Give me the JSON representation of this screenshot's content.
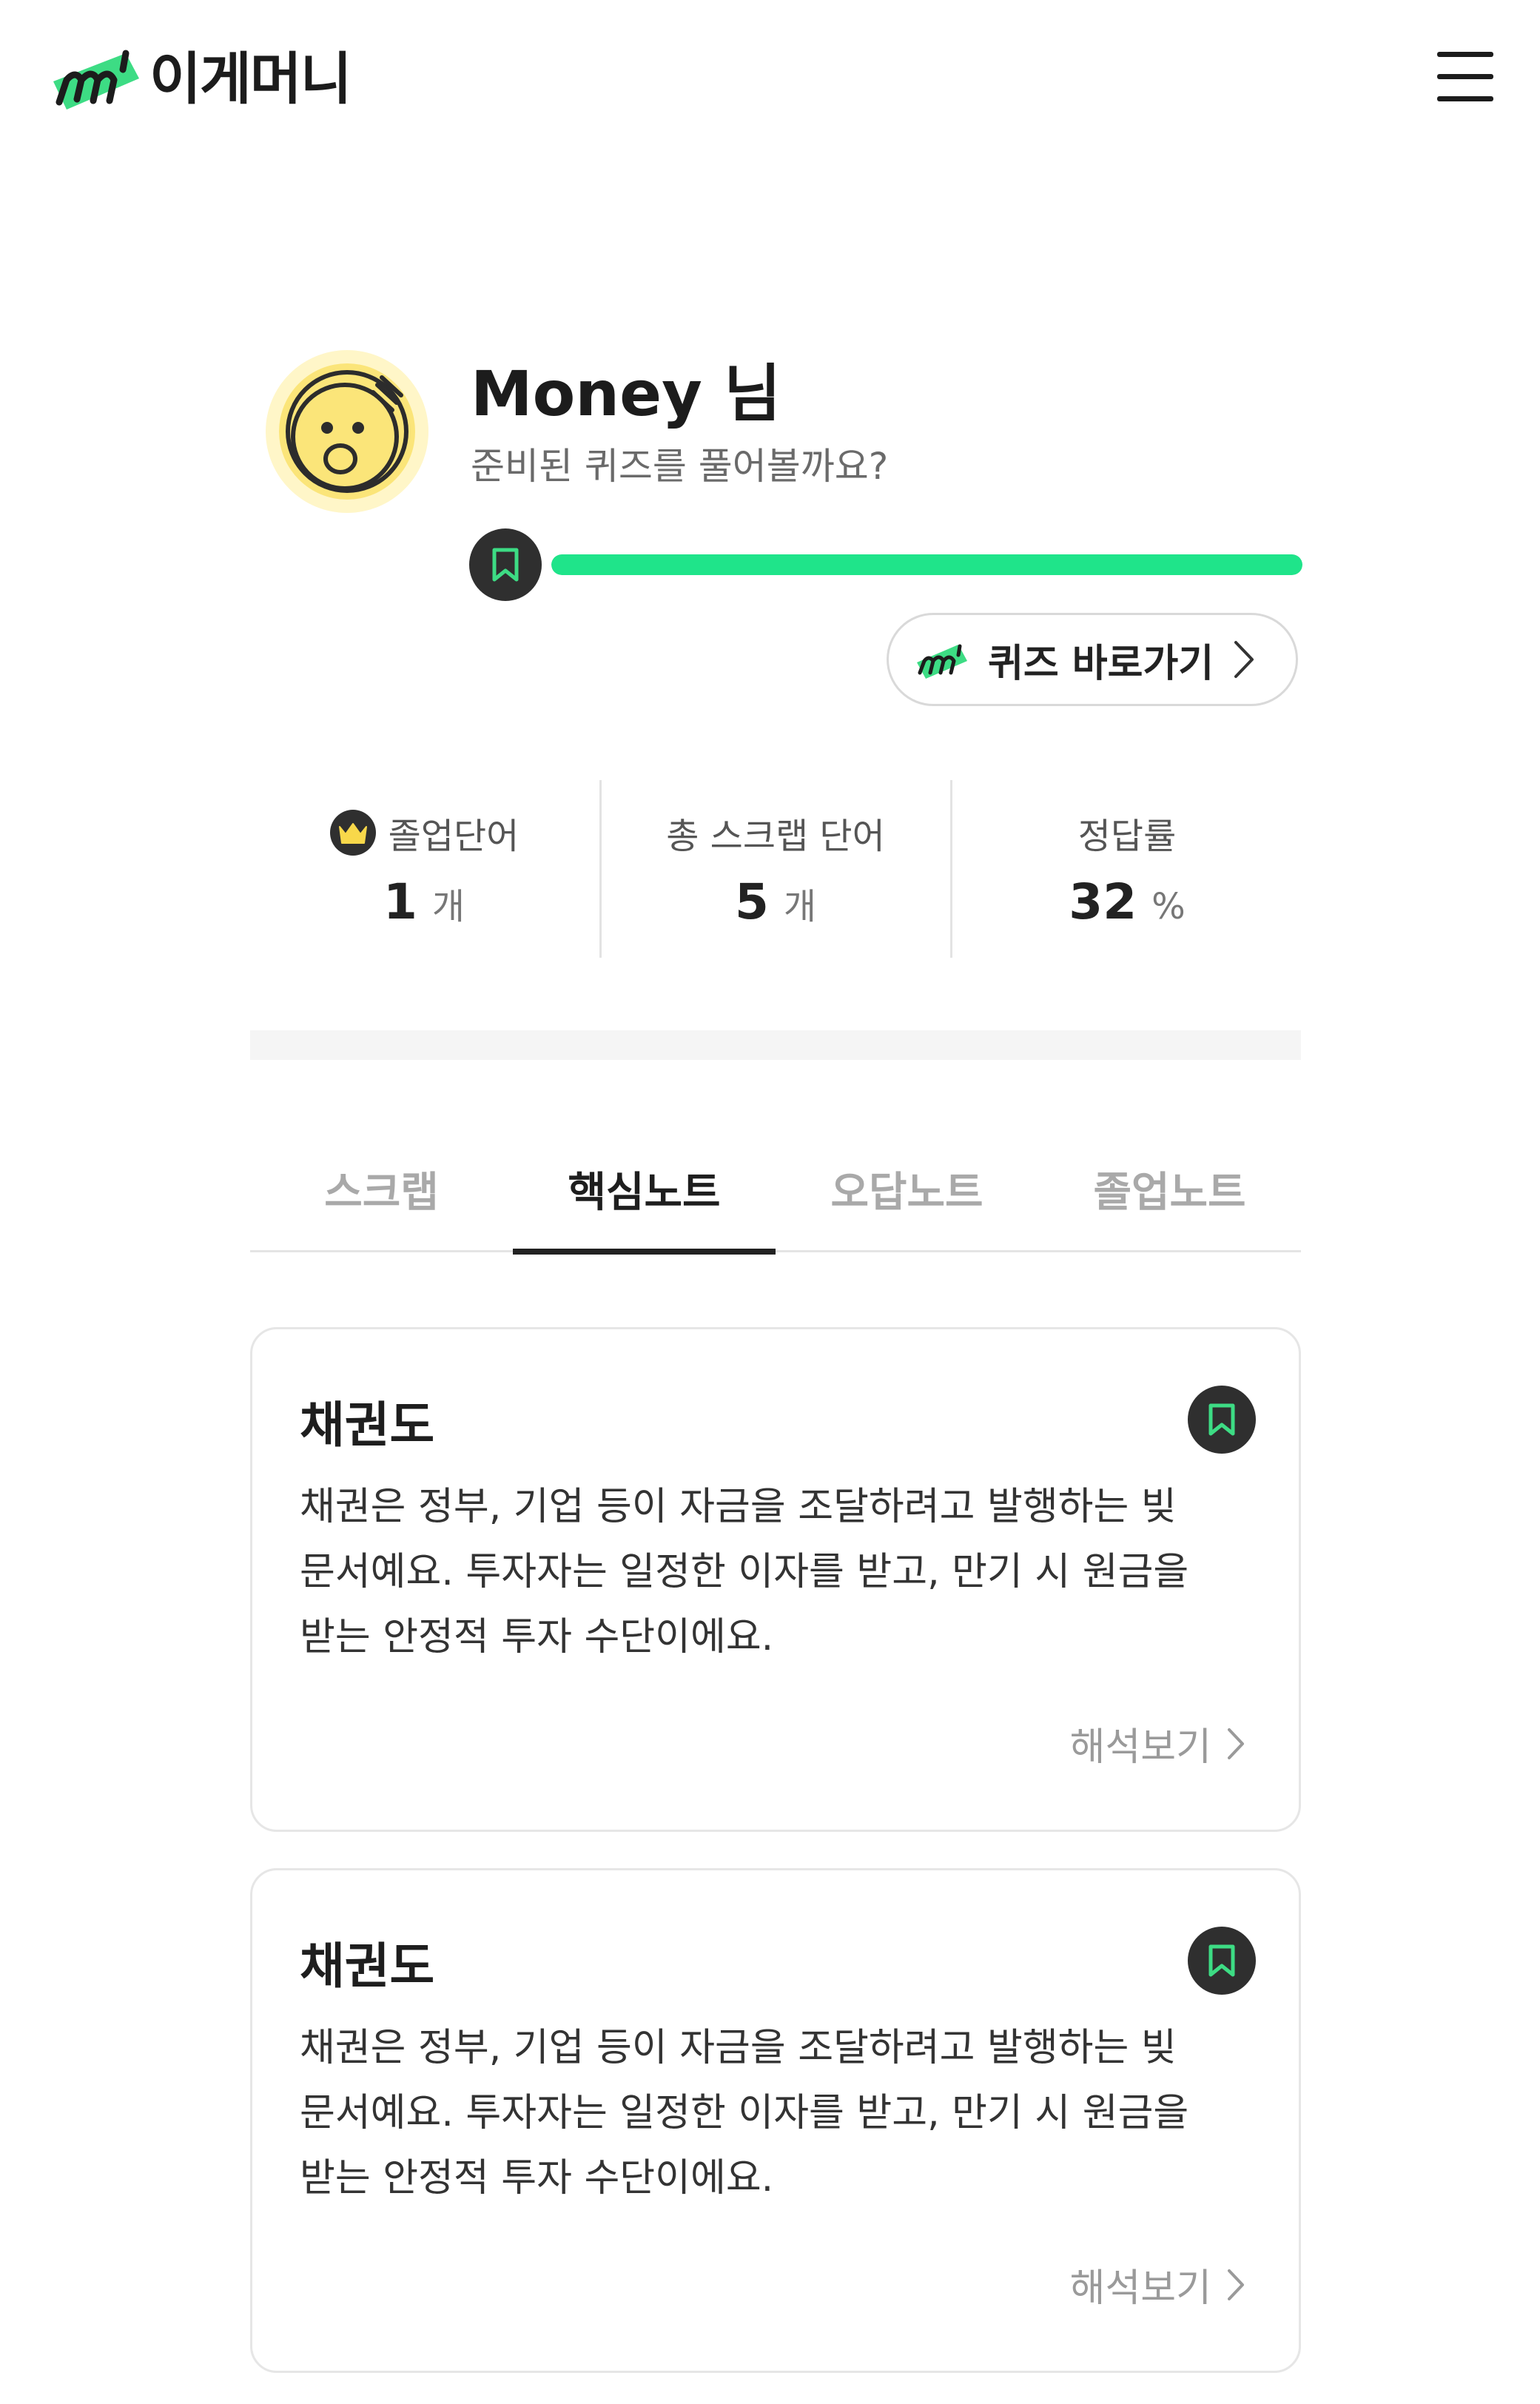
{
  "app": {
    "brand_name": "이게머니",
    "accent_color": "#1fe48a",
    "brand_green": "#3ddc84",
    "dark_color": "#2f2f2f"
  },
  "header": {
    "logo_icon": "brand-m-logo",
    "menu_icon": "hamburger-menu-icon"
  },
  "profile": {
    "name": "Money 님",
    "subtitle": "준비된 퀴즈를 풀어볼까요?",
    "avatar_icon": "coin-face-icon",
    "progress_icon": "bookmark-icon",
    "progress_fraction": 1.0
  },
  "quiz_button": {
    "label": "퀴즈 바로가기",
    "icon": "brand-m-logo",
    "chevron_icon": "chevron-right-icon"
  },
  "stats": [
    {
      "label": "졸업단어",
      "value": "1",
      "unit": "개",
      "icon": "crown-icon"
    },
    {
      "label": "총 스크랩 단어",
      "value": "5",
      "unit": "개"
    },
    {
      "label": "정답률",
      "value": "32",
      "unit": "%"
    }
  ],
  "tabs": [
    {
      "label": "스크랩",
      "active": false
    },
    {
      "label": "핵심노트",
      "active": true
    },
    {
      "label": "오답노트",
      "active": false
    },
    {
      "label": "졸업노트",
      "active": false
    }
  ],
  "cards": [
    {
      "title": "채권도",
      "body": "채권은 정부, 기업 등이 자금을 조달하려고 발행하는 빚 문서예요. 투자자는 일정한 이자를 받고, 만기 시 원금을 받는 안정적 투자 수단이에요.",
      "link_label": "해석보기",
      "bookmark_icon": "bookmark-icon"
    },
    {
      "title": "채권도",
      "body": "채권은 정부, 기업 등이 자금을 조달하려고 발행하는 빚 문서예요. 투자자는 일정한 이자를 받고, 만기 시 원금을 받는 안정적 투자 수단이에요.",
      "link_label": "해석보기",
      "bookmark_icon": "bookmark-icon"
    }
  ]
}
